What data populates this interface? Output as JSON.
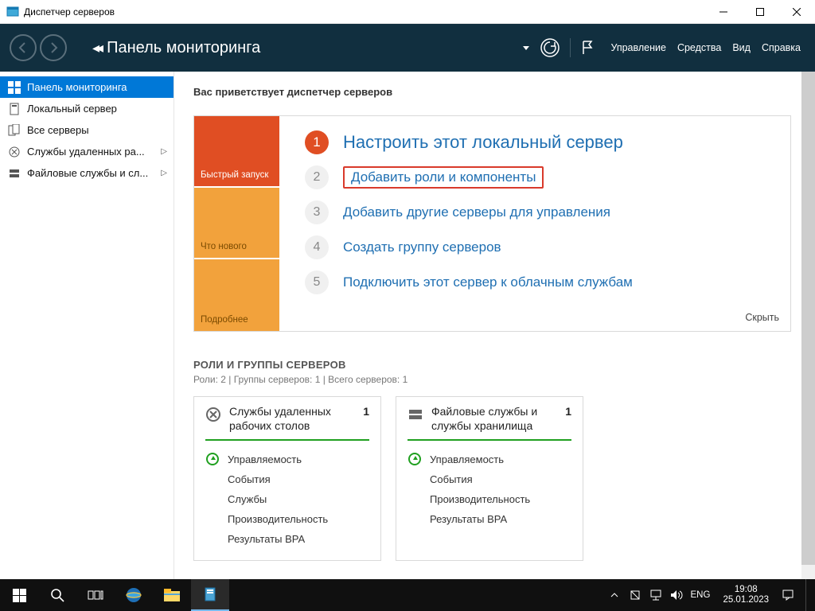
{
  "window": {
    "title": "Диспетчер серверов"
  },
  "header": {
    "page_title": "Панель мониторинга",
    "menu": {
      "manage": "Управление",
      "tools": "Средства",
      "view": "Вид",
      "help": "Справка"
    }
  },
  "sidebar": {
    "items": [
      {
        "label": "Панель мониторинга",
        "active": true
      },
      {
        "label": "Локальный сервер"
      },
      {
        "label": "Все серверы"
      },
      {
        "label": "Службы удаленных ра...",
        "has_sub": true
      },
      {
        "label": "Файловые службы и сл...",
        "has_sub": true
      }
    ]
  },
  "welcome": {
    "title": "Вас приветствует диспетчер серверов",
    "tabs": {
      "quickstart": "Быстрый запуск",
      "whatsnew": "Что нового",
      "learnmore": "Подробнее"
    },
    "steps": [
      {
        "n": "1",
        "label": "Настроить этот локальный сервер",
        "primary": true
      },
      {
        "n": "2",
        "label": "Добавить роли и компоненты",
        "highlight": true
      },
      {
        "n": "3",
        "label": "Добавить другие серверы для управления"
      },
      {
        "n": "4",
        "label": "Создать группу серверов"
      },
      {
        "n": "5",
        "label": "Подключить этот сервер к облачным службам"
      }
    ],
    "hide": "Скрыть"
  },
  "roles": {
    "heading": "РОЛИ И ГРУППЫ СЕРВЕРОВ",
    "subheading": "Роли: 2 | Группы серверов: 1 | Всего серверов: 1",
    "cards": [
      {
        "title": "Службы удаленных рабочих столов",
        "count": "1",
        "rows": [
          "Управляемость",
          "События",
          "Службы",
          "Производительность",
          "Результаты BPA"
        ]
      },
      {
        "title": "Файловые службы и службы хранилища",
        "count": "1",
        "rows": [
          "Управляемость",
          "События",
          "Производительность",
          "Результаты BPA"
        ]
      }
    ]
  },
  "taskbar": {
    "lang": "ENG",
    "time": "19:08",
    "date": "25.01.2023"
  }
}
